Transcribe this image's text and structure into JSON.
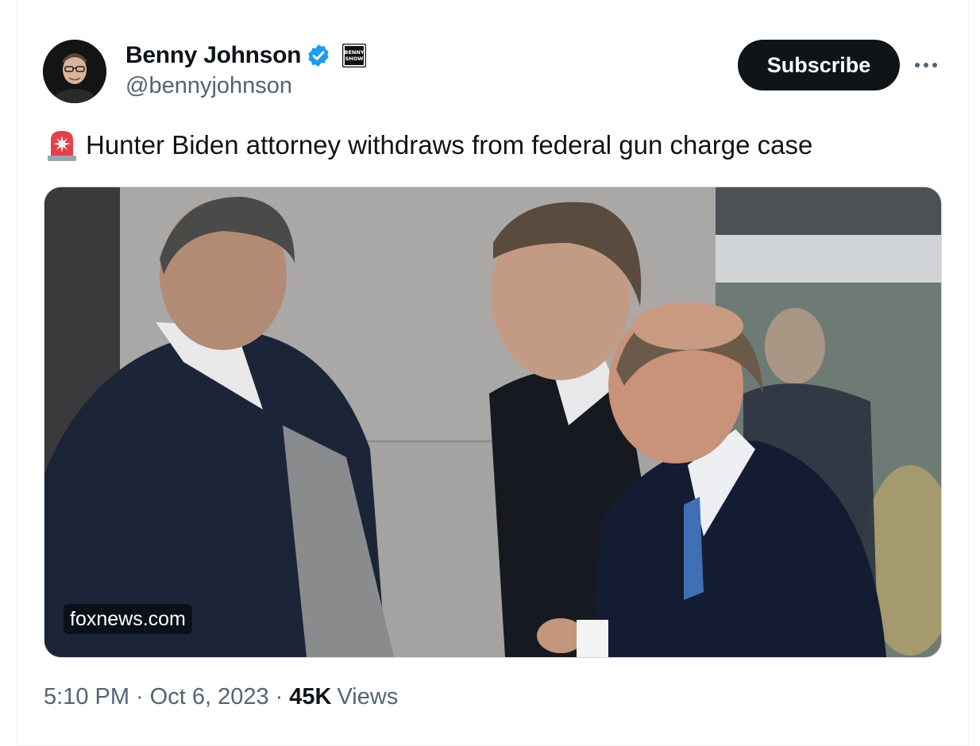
{
  "author": {
    "display_name": "Benny Johnson",
    "handle": "@bennyjohnson",
    "avatar_icon": "avatar-photo",
    "verified_icon": "verified-badge-icon",
    "affiliate_badge_text": "BENNY SHOW",
    "verified_color": "#1d9bf0"
  },
  "actions": {
    "subscribe_label": "Subscribe",
    "more_icon": "more-options-icon"
  },
  "tweet": {
    "emoji_icon": "rotating-light-icon",
    "text": "Hunter Biden attorney withdraws from federal gun charge case"
  },
  "media": {
    "source_label": "foxnews.com",
    "description_icon": "news-photo"
  },
  "meta": {
    "time": "5:10 PM",
    "separator": "·",
    "date": "Oct 6, 2023",
    "views_count": "45K",
    "views_label": "Views"
  },
  "colors": {
    "text_primary": "#0f1419",
    "text_secondary": "#536471",
    "button_bg": "#0f1419",
    "border": "#cfd9de"
  }
}
